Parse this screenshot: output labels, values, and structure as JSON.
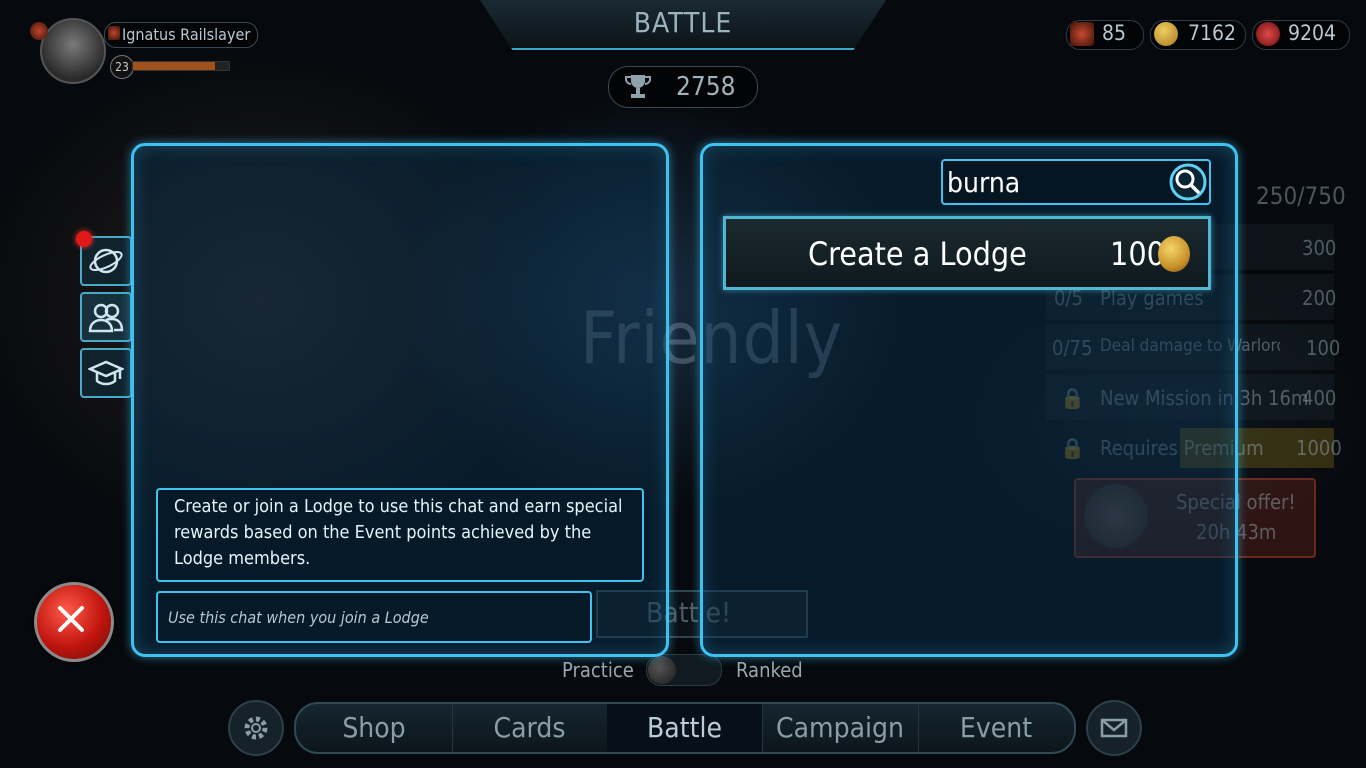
{
  "screen_title": "BATTLE",
  "player": {
    "name": "Ignatus Railslayer",
    "level": "23",
    "xp_fraction": 0.85
  },
  "currencies": [
    {
      "icon": "cards-currency-icon",
      "value": "85"
    },
    {
      "icon": "gold-coin-icon",
      "value": "7162"
    },
    {
      "icon": "red-gem-icon",
      "value": "9204"
    }
  ],
  "trophies": "2758",
  "background": {
    "mode_label": "Friendly",
    "event_points": "250/750",
    "missions": [
      {
        "progress": "",
        "label": "",
        "reward": "300"
      },
      {
        "progress": "0/5",
        "label": "Play games",
        "reward": "200"
      },
      {
        "progress": "0/75",
        "label": "Deal damage to Warlord",
        "reward": "100"
      },
      {
        "progress": "",
        "label": "New Mission in 3h 16m",
        "reward": "400"
      },
      {
        "progress": "",
        "label": "Requires Premium",
        "reward": "1000"
      }
    ],
    "special_offer": {
      "title": "Special offer!",
      "timer": "20h 43m"
    },
    "battle_button": "Battle!",
    "toggle": {
      "left": "Practice",
      "right": "Ranked"
    }
  },
  "bottom_nav": [
    "Shop",
    "Cards",
    "Battle",
    "Campaign",
    "Event"
  ],
  "bottom_nav_active": "Battle",
  "lodge_chat": {
    "info": "Create or join a Lodge to use this chat and earn special rewards based on the Event points achieved by the Lodge members.",
    "input_placeholder": "Use this chat when you join a Lodge"
  },
  "lodge_search": {
    "search_value": "burna",
    "create_label": "Create a Lodge",
    "create_cost": "100"
  },
  "side_tabs": [
    "globe-chat-icon",
    "lodge-members-icon",
    "academy-cap-icon"
  ],
  "colors": {
    "panel_border": "#3ec2f0",
    "notification": "#e01818",
    "close_button": "#c0150e"
  }
}
